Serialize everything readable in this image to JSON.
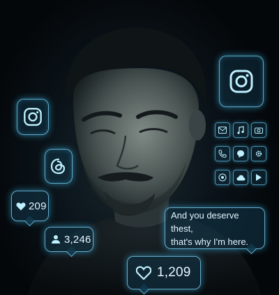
{
  "notifications": {
    "likes_small": "209",
    "followers": "3,246",
    "likes_large": "1,209"
  },
  "message": {
    "line1": "And you deserve thest,",
    "line2": "that's why I'm here."
  },
  "icons": [
    "instagram-icon",
    "threads-icon",
    "mail-icon",
    "music-icon",
    "camera-icon",
    "phone-icon",
    "chat-icon",
    "settings-icon",
    "record-icon",
    "cloud-icon",
    "play-icon",
    "heart-icon",
    "person-icon"
  ],
  "colors": {
    "glow": "#6fd8ff",
    "background": "#05090d"
  }
}
